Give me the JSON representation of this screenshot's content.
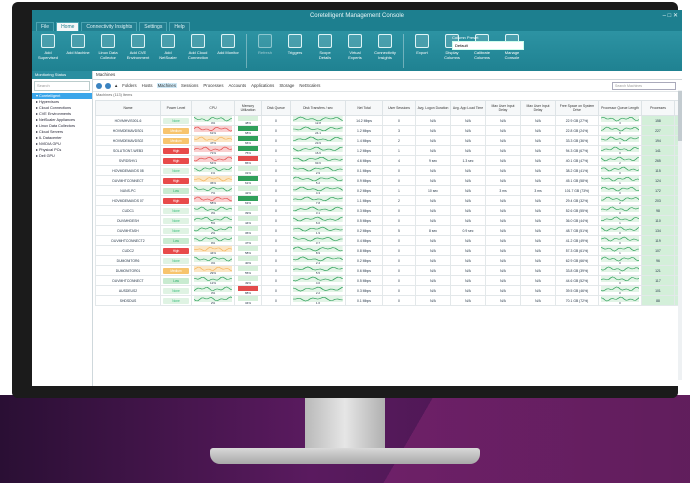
{
  "window": {
    "title": "Coretelligent Management Console",
    "controls": [
      "–",
      "□",
      "✕"
    ]
  },
  "menu": {
    "tabs": [
      "File",
      "Home",
      "Connectivity Insights",
      "Settings",
      "Help"
    ],
    "active_index": 1
  },
  "ribbon": {
    "buttons": [
      {
        "label": "Add Supervised",
        "icon": "add-supervised-icon"
      },
      {
        "label": "Add Machine",
        "icon": "add-machine-icon"
      },
      {
        "label": "Linux Data Collector",
        "icon": "linux-collector-icon"
      },
      {
        "label": "Add CVE Environment",
        "icon": "cve-environment-icon"
      },
      {
        "label": "Add NetScaler",
        "icon": "netscaler-icon"
      },
      {
        "label": "Add Cloud Connection",
        "icon": "cloud-connection-icon"
      },
      {
        "label": "Add Monitor",
        "icon": "monitor-icon"
      },
      {
        "label": "Refresh",
        "icon": "refresh-icon",
        "dim": true
      },
      {
        "label": "Triggers",
        "icon": "triggers-icon"
      },
      {
        "label": "Scope Details",
        "icon": "scope-details-icon"
      },
      {
        "label": "Virtual Experts",
        "icon": "virtual-experts-icon"
      },
      {
        "label": "Connectivity Insights",
        "icon": "connectivity-icon"
      },
      {
        "label": "Export",
        "icon": "export-icon"
      },
      {
        "label": "Display Columns",
        "icon": "display-columns-icon"
      },
      {
        "label": "Calibrate Columns",
        "icon": "calibrate-columns-icon"
      },
      {
        "label": "Manage Console",
        "icon": "manage-console-icon"
      }
    ],
    "quickfind": {
      "label": "Column Preset",
      "value": "Default"
    }
  },
  "left_pane": {
    "header": "Monitoring Status",
    "search_placeholder": "Search",
    "tree": [
      {
        "label": "Coretelligent",
        "selected": true
      },
      {
        "label": "Hypervisors",
        "selected": false
      },
      {
        "label": "Cloud Connections",
        "selected": false
      },
      {
        "label": "CVE Environments",
        "selected": false
      },
      {
        "label": "NetScaler Appliances",
        "selected": false
      },
      {
        "label": "Linux Data Collectors",
        "selected": false
      },
      {
        "label": "Cloud Servers",
        "selected": false
      },
      {
        "label": "IL Datacenter",
        "selected": false
      },
      {
        "label": "NVIDIA GPU",
        "selected": false
      },
      {
        "label": "Physical PCs",
        "selected": false
      },
      {
        "label": "Dell GPU",
        "selected": false
      }
    ]
  },
  "right_pane": {
    "tab": "Machines",
    "breadcrumbs": [
      "Folders",
      "Hosts",
      "Machines",
      "Sessions",
      "Processes",
      "Accounts",
      "Applications",
      "Storage",
      "NetScalers"
    ],
    "active_breadcrumb": 2,
    "search_placeholder": "Search Machines",
    "count_text": "Machines (113) Items",
    "columns": [
      "Name",
      "Power Level",
      "CPU",
      "Memory Utilization",
      "Disk Queue",
      "Disk Transfers / sec",
      "Net Total",
      "User Sessions",
      "Avg. Logon Duration",
      "Avg. App Load Time",
      "Max User Input Delay",
      "Max User Input Delay",
      "Free Space on System Drive",
      "Processor Queue Length",
      "Processes",
      "Paging File"
    ],
    "rows": [
      {
        "name": "HOVMHVIS001-6",
        "power": "None",
        "power_level": "none",
        "cpu": "4%",
        "mem": "48%",
        "queue": "0",
        "transfers": "12.8",
        "net": "14.2 Mbps",
        "sessions": "0",
        "logon": "N/A",
        "appload": "N/A",
        "delay1": "N/A",
        "delay2": "N/A",
        "free": "22.9 GB (27%)",
        "pql": "3",
        "procs": "158",
        "paging": "15%"
      },
      {
        "name": "HOVMDEMAVDS01",
        "power": "Medium",
        "power_level": "med",
        "cpu": "61%",
        "mem": "68%",
        "queue": "0",
        "transfers": "24.1",
        "net": "1.2 Mbps",
        "sessions": "3",
        "logon": "N/A",
        "appload": "N/A",
        "delay1": "N/A",
        "delay2": "N/A",
        "free": "22.8 GB (24%)",
        "pql": "6",
        "procs": "227",
        "paging": "9%"
      },
      {
        "name": "HOVMDEMAVDS02",
        "power": "Medium",
        "power_level": "med",
        "cpu": "47%",
        "mem": "66%",
        "queue": "0",
        "transfers": "23.9",
        "net": "1.4 Mbps",
        "sessions": "2",
        "logon": "N/A",
        "appload": "N/A",
        "delay1": "N/A",
        "delay2": "N/A",
        "free": "33.3 GB (36%)",
        "pql": "1",
        "procs": "194",
        "paging": "9%"
      },
      {
        "name": "SOLUTION7-WEB3",
        "power": "High",
        "power_level": "high",
        "cpu": "71%",
        "mem": "75%",
        "queue": "0",
        "transfers": "16.6",
        "net": "1.2 Mbps",
        "sessions": "1",
        "logon": "N/A",
        "appload": "N/A",
        "delay1": "N/A",
        "delay2": "N/A",
        "free": "94.3 GB (67%)",
        "pql": "0",
        "procs": "141",
        "paging": "6%"
      },
      {
        "name": "SVRDSHV1",
        "power": "High",
        "power_level": "high",
        "cpu": "54%",
        "mem": "86%",
        "queue": "1",
        "transfers": "93.6",
        "net": "4.6 Mbps",
        "sessions": "4",
        "logon": "9 sec",
        "appload": "1.3 sec",
        "delay1": "N/A",
        "delay2": "N/A",
        "free": "40.1 GB (47%)",
        "pql": "2",
        "procs": "265",
        "paging": "22%"
      },
      {
        "name": "HOVMDEMAVDS 08",
        "power": "None",
        "power_level": "none",
        "cpu": "1%",
        "mem": "31%",
        "queue": "0",
        "transfers": "2.9",
        "net": "0.1 Mbps",
        "sessions": "0",
        "logon": "N/A",
        "appload": "N/A",
        "delay1": "N/A",
        "delay2": "N/A",
        "free": "38.2 GB (41%)",
        "pql": "0",
        "procs": "115",
        "paging": "3%"
      },
      {
        "name": "DUVMHTCONNECT",
        "power": "High",
        "power_level": "high",
        "cpu": "36%",
        "mem": "61%",
        "queue": "0",
        "transfers": "5.2",
        "net": "0.9 Mbps",
        "sessions": "0",
        "logon": "N/A",
        "appload": "N/A",
        "delay1": "N/A",
        "delay2": "N/A",
        "free": "45.1 GB (58%)",
        "pql": "1",
        "procs": "124",
        "paging": "4%"
      },
      {
        "name": "NUNS-PC",
        "power": "Low",
        "power_level": "low",
        "cpu": "7%",
        "mem": "42%",
        "queue": "0",
        "transfers": "4.3",
        "net": "0.2 Mbps",
        "sessions": "1",
        "logon": "10 sec",
        "appload": "N/A",
        "delay1": "3 ms",
        "delay2": "3 ms",
        "free": "101.7 GB (73%)",
        "pql": "0",
        "procs": "172",
        "paging": "8%"
      },
      {
        "name": "HOVMDEMAVDS 07",
        "power": "High",
        "power_level": "high",
        "cpu": "58%",
        "mem": "63%",
        "queue": "0",
        "transfers": "7.8",
        "net": "1.1 Mbps",
        "sessions": "2",
        "logon": "N/A",
        "appload": "N/A",
        "delay1": "N/A",
        "delay2": "N/A",
        "free": "29.4 GB (32%)",
        "pql": "2",
        "procs": "203",
        "paging": "11%"
      },
      {
        "name": "CUDC1",
        "power": "None",
        "power_level": "none",
        "cpu": "3%",
        "mem": "39%",
        "queue": "0",
        "transfers": "3.1",
        "net": "0.3 Mbps",
        "sessions": "0",
        "logon": "N/A",
        "appload": "N/A",
        "delay1": "N/A",
        "delay2": "N/A",
        "free": "52.6 GB (55%)",
        "pql": "0",
        "procs": "98",
        "paging": "2%"
      },
      {
        "name": "DUVMHDESH",
        "power": "None",
        "power_level": "none",
        "cpu": "5%",
        "mem": "44%",
        "queue": "0",
        "transfers": "6.0",
        "net": "0.5 Mbps",
        "sessions": "0",
        "logon": "N/A",
        "appload": "N/A",
        "delay1": "N/A",
        "delay2": "N/A",
        "free": "36.0 GB (44%)",
        "pql": "1",
        "procs": "110",
        "paging": "5%"
      },
      {
        "name": "DUVMHTASH",
        "power": "None",
        "power_level": "none",
        "cpu": "2%",
        "mem": "36%",
        "queue": "0",
        "transfers": "1.9",
        "net": "0.2 Mbps",
        "sessions": "5",
        "logon": "8 sec",
        "appload": "0.9 sec",
        "delay1": "N/A",
        "delay2": "N/A",
        "free": "48.7 GB (51%)",
        "pql": "0",
        "procs": "134",
        "paging": "3%"
      },
      {
        "name": "DUVMHTCONNECT2",
        "power": "Low",
        "power_level": "low",
        "cpu": "9%",
        "mem": "47%",
        "queue": "0",
        "transfers": "3.7",
        "net": "0.4 Mbps",
        "sessions": "0",
        "logon": "N/A",
        "appload": "N/A",
        "delay1": "N/A",
        "delay2": "N/A",
        "free": "41.2 GB (49%)",
        "pql": "0",
        "procs": "119",
        "paging": "4%"
      },
      {
        "name": "CUDC2",
        "power": "High",
        "power_level": "high",
        "cpu": "44%",
        "mem": "58%",
        "queue": "0",
        "transfers": "8.9",
        "net": "0.8 Mbps",
        "sessions": "0",
        "logon": "N/A",
        "appload": "N/A",
        "delay1": "N/A",
        "delay2": "N/A",
        "free": "57.3 GB (61%)",
        "pql": "1",
        "procs": "107",
        "paging": "6%"
      },
      {
        "name": "DUMONITOR6",
        "power": "None",
        "power_level": "none",
        "cpu": "4%",
        "mem": "40%",
        "queue": "0",
        "transfers": "2.4",
        "net": "0.2 Mbps",
        "sessions": "0",
        "logon": "N/A",
        "appload": "N/A",
        "delay1": "N/A",
        "delay2": "N/A",
        "free": "62.9 GB (66%)",
        "pql": "0",
        "procs": "96",
        "paging": "3%"
      },
      {
        "name": "DUMONITOR01",
        "power": "Medium",
        "power_level": "med",
        "cpu": "29%",
        "mem": "55%",
        "queue": "0",
        "transfers": "5.5",
        "net": "0.6 Mbps",
        "sessions": "0",
        "logon": "N/A",
        "appload": "N/A",
        "delay1": "N/A",
        "delay2": "N/A",
        "free": "33.8 GB (39%)",
        "pql": "1",
        "procs": "121",
        "paging": "7%"
      },
      {
        "name": "DUVMHTCONNECT",
        "power": "Low",
        "power_level": "low",
        "cpu": "12%",
        "mem": "49%",
        "queue": "0",
        "transfers": "4.0",
        "net": "0.5 Mbps",
        "sessions": "0",
        "logon": "N/A",
        "appload": "N/A",
        "delay1": "N/A",
        "delay2": "N/A",
        "free": "44.6 GB (52%)",
        "pql": "0",
        "procs": "117",
        "paging": "5%"
      },
      {
        "name": "AUSDEUS2",
        "power": "None",
        "power_level": "none",
        "cpu": "3%",
        "mem": "88%",
        "queue": "0",
        "transfers": "2.2",
        "net": "0.3 Mbps",
        "sessions": "0",
        "logon": "N/A",
        "appload": "N/A",
        "delay1": "N/A",
        "delay2": "N/A",
        "free": "39.5 GB (46%)",
        "pql": "0",
        "procs": "101",
        "paging": "4%"
      },
      {
        "name": "SHDSDUS",
        "power": "None",
        "power_level": "none",
        "cpu": "2%",
        "mem": "34%",
        "queue": "0",
        "transfers": "1.6",
        "net": "0.1 Mbps",
        "sessions": "0",
        "logon": "N/A",
        "appload": "N/A",
        "delay1": "N/A",
        "delay2": "N/A",
        "free": "70.1 GB (72%)",
        "pql": "0",
        "procs": "88",
        "paging": "2%"
      }
    ]
  },
  "colors": {
    "accent": "#1d7f8f",
    "selection": "#3aa6ea",
    "ok": "#2fa05a",
    "warn": "#f3b35a",
    "crit": "#e24b4b",
    "bezel": "#1b1b1b",
    "backdrop": "#5a1a5f"
  }
}
